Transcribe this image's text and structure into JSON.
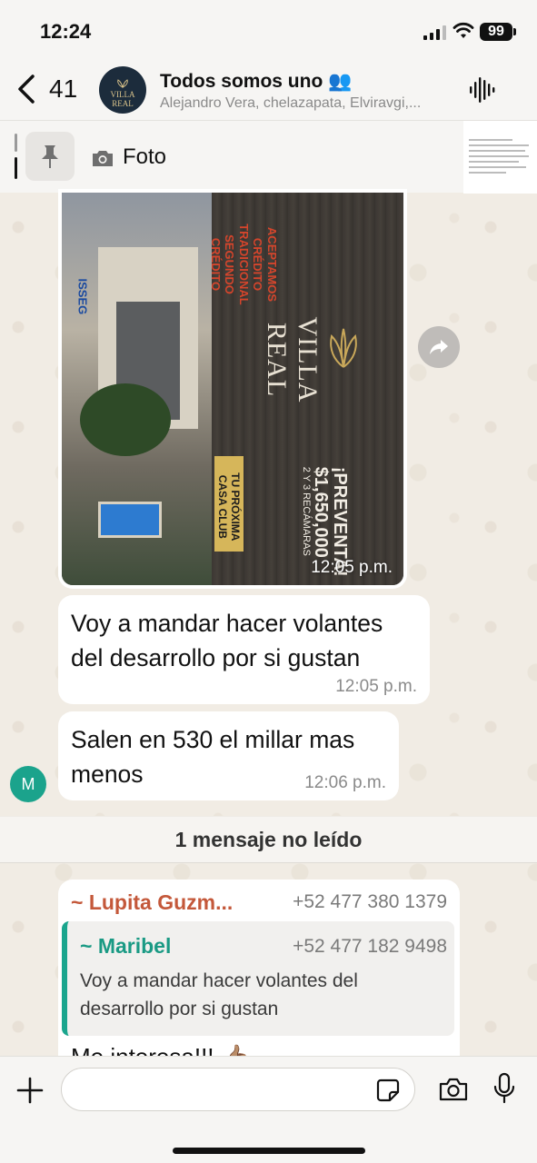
{
  "status_bar": {
    "time": "12:24",
    "battery": "99"
  },
  "header": {
    "back_count": "41",
    "avatar_text": "VILLA REAL",
    "group_name": "Todos somos uno 👥",
    "members": "Alejandro Vera, chelazapata, Elviravgi,..."
  },
  "pinned": {
    "label": "Foto"
  },
  "image_message": {
    "time": "12:05 p.m.",
    "flyer": {
      "brand": "VILLA REAL",
      "slogan": "ACEPTAMOS\nCRÉDITO TRADICIONAL\nSEGUNDO CRÉDITO",
      "isseg": "ISSEG",
      "tagline": "TU PRÓXIMA\nCASA CLUB",
      "price": "¡PREVENTA!\n$1,650,000",
      "rooms": "2 Y 3 RECÁMARAS"
    }
  },
  "messages": [
    {
      "text": "Voy a mandar hacer volantes del desarrollo por si gustan",
      "time": "12:05 p.m."
    },
    {
      "text": "Salen en 530 el millar mas menos",
      "time": "12:06 p.m."
    }
  ],
  "sender_avatar": "M",
  "unread": "1 mensaje no leído",
  "reply_message": {
    "sender": "~ Lupita Guzm...",
    "sender_phone": "+52 477 380 1379",
    "quoted_sender": "~ Maribel",
    "quoted_phone": "+52 477 182 9498",
    "quoted_text": "Voy a mandar hacer volantes del desarrollo por si gustan",
    "text": "Me interesa!!! 👍🏽"
  },
  "compose": {
    "placeholder": ""
  },
  "colors": {
    "accent_green": "#1aa58d",
    "sender_orange": "#c4583a",
    "bubble": "#ffffff",
    "wallpaper": "#efeae2"
  }
}
